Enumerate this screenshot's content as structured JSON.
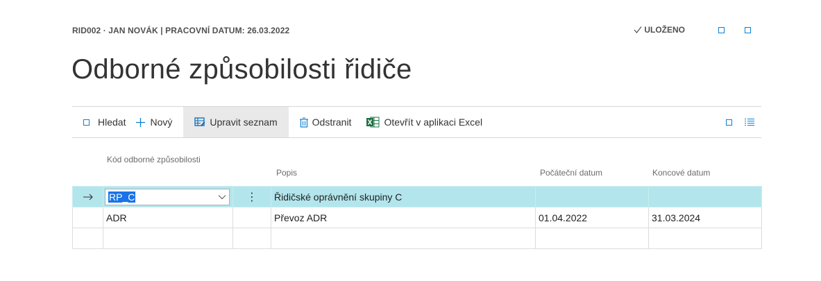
{
  "header": {
    "breadcrumb": "RID002 · JAN NOVÁK | PRACOVNÍ DATUM: 26.03.2022",
    "saved_status": "ULOŽENO",
    "title": "Odborné způsobilosti řidiče"
  },
  "actions": {
    "search": "Hledat",
    "new": "Nový",
    "edit_list": "Upravit seznam",
    "delete": "Odstranit",
    "open_excel": "Otevřít v aplikaci Excel"
  },
  "columns": {
    "code": "Kód odborné způsobilosti",
    "description": "Popis",
    "start_date": "Počáteční datum",
    "end_date": "Koncové datum"
  },
  "rows": [
    {
      "code": "RP_C",
      "description": "Řidičské oprávnění skupiny C",
      "start_date": "",
      "end_date": ""
    },
    {
      "code": "ADR",
      "description": "Převoz ADR",
      "start_date": "01.04.2022",
      "end_date": "31.03.2024"
    },
    {
      "code": "",
      "description": "",
      "start_date": "",
      "end_date": ""
    }
  ],
  "colors": {
    "accent": "#0a7fd0",
    "selected_row": "#b3e5ec",
    "excel_green": "#1e7145"
  }
}
